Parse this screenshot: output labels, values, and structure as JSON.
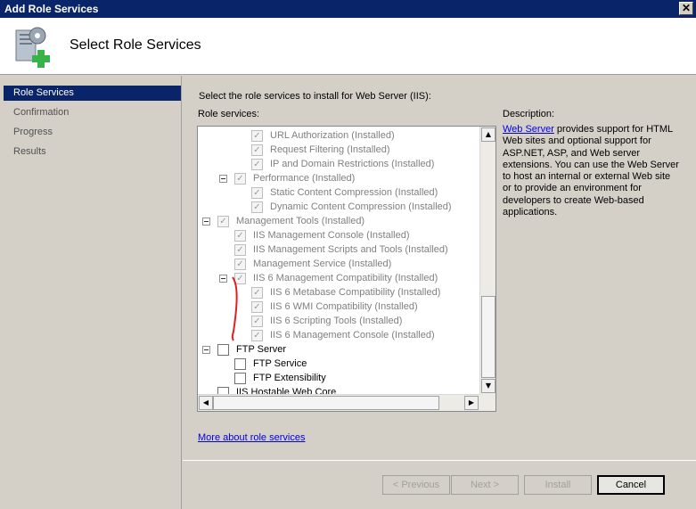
{
  "window": {
    "title": "Add Role Services",
    "close_glyph": "✕"
  },
  "header": {
    "title": "Select Role Services",
    "icon": "server-add-icon"
  },
  "nav": {
    "items": [
      {
        "label": "Role Services",
        "active": true
      },
      {
        "label": "Confirmation",
        "active": false
      },
      {
        "label": "Progress",
        "active": false
      },
      {
        "label": "Results",
        "active": false
      }
    ]
  },
  "main": {
    "instruction": "Select the role services to install for Web Server (IIS):",
    "role_services_label": "Role services:",
    "description_label": "Description:",
    "description_link": "Web Server",
    "description_text": " provides support for HTML Web sites and optional support for ASP.NET, ASP, and Web server extensions. You can use the Web Server to host an internal or external Web site or to provide an environment for developers to create Web-based applications.",
    "more_link": "More about role services",
    "tree": [
      {
        "label": "URL Authorization  (Installed)",
        "level": 2,
        "checked": true,
        "enabled": false,
        "expander": false
      },
      {
        "label": "Request Filtering  (Installed)",
        "level": 2,
        "checked": true,
        "enabled": false,
        "expander": false
      },
      {
        "label": "IP and Domain Restrictions  (Installed)",
        "level": 2,
        "checked": true,
        "enabled": false,
        "expander": false
      },
      {
        "label": "Performance  (Installed)",
        "level": 1,
        "checked": true,
        "enabled": false,
        "expander": true
      },
      {
        "label": "Static Content Compression  (Installed)",
        "level": 2,
        "checked": true,
        "enabled": false,
        "expander": false
      },
      {
        "label": "Dynamic Content Compression  (Installed)",
        "level": 2,
        "checked": true,
        "enabled": false,
        "expander": false
      },
      {
        "label": "Management Tools  (Installed)",
        "level": 0,
        "checked": true,
        "enabled": false,
        "expander": true
      },
      {
        "label": "IIS Management Console  (Installed)",
        "level": 1,
        "checked": true,
        "enabled": false,
        "expander": false
      },
      {
        "label": "IIS Management Scripts and Tools  (Installed)",
        "level": 1,
        "checked": true,
        "enabled": false,
        "expander": false
      },
      {
        "label": "Management Service  (Installed)",
        "level": 1,
        "checked": true,
        "enabled": false,
        "expander": false
      },
      {
        "label": "IIS 6 Management Compatibility  (Installed)",
        "level": 1,
        "checked": true,
        "enabled": false,
        "expander": true
      },
      {
        "label": "IIS 6 Metabase Compatibility  (Installed)",
        "level": 2,
        "checked": true,
        "enabled": false,
        "expander": false
      },
      {
        "label": "IIS 6 WMI Compatibility  (Installed)",
        "level": 2,
        "checked": true,
        "enabled": false,
        "expander": false
      },
      {
        "label": "IIS 6 Scripting Tools  (Installed)",
        "level": 2,
        "checked": true,
        "enabled": false,
        "expander": false
      },
      {
        "label": "IIS 6 Management Console  (Installed)",
        "level": 2,
        "checked": true,
        "enabled": false,
        "expander": false
      },
      {
        "label": "FTP Server",
        "level": 0,
        "checked": false,
        "enabled": true,
        "expander": true
      },
      {
        "label": "FTP Service",
        "level": 1,
        "checked": false,
        "enabled": true,
        "expander": false
      },
      {
        "label": "FTP Extensibility",
        "level": 1,
        "checked": false,
        "enabled": true,
        "expander": false
      },
      {
        "label": "IIS Hostable Web Core",
        "level": 0,
        "checked": false,
        "enabled": true,
        "expander": false
      }
    ]
  },
  "buttons": {
    "previous": "< Previous",
    "next": "Next >",
    "install": "Install",
    "cancel": "Cancel"
  },
  "colors": {
    "accent": "#0a246a",
    "link": "#0000ee",
    "annotation": "#e02020"
  }
}
